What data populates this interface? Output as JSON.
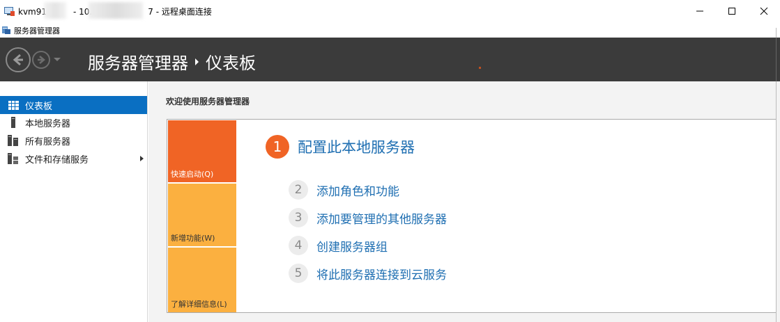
{
  "remote_desktop": {
    "title_prefix": "kvm91",
    "title_middle": "- 10.",
    "title_suffix": "7 - 远程桌面连接"
  },
  "server_manager_window": {
    "title": "服务器管理器"
  },
  "header": {
    "breadcrumb_root": "服务器管理器",
    "breadcrumb_current": "仪表板"
  },
  "sidebar": {
    "items": [
      {
        "label": "仪表板",
        "icon": "dashboard-icon",
        "active": true
      },
      {
        "label": "本地服务器",
        "icon": "local-server-icon",
        "active": false
      },
      {
        "label": "所有服务器",
        "icon": "all-servers-icon",
        "active": false
      },
      {
        "label": "文件和存储服务",
        "icon": "file-storage-icon",
        "active": false,
        "has_submenu": true
      }
    ]
  },
  "main": {
    "welcome": "欢迎使用服务器管理器",
    "tiles": [
      {
        "label": "快速启动(Q)",
        "color": "#f06425"
      },
      {
        "label": "新增功能(W)",
        "color": "#fbb040"
      },
      {
        "label": "了解详细信息(L)",
        "color": "#fbb040"
      }
    ],
    "steps": [
      {
        "num": "1",
        "label": "配置此本地服务器"
      },
      {
        "num": "2",
        "label": "添加角色和功能"
      },
      {
        "num": "3",
        "label": "添加要管理的其他服务器"
      },
      {
        "num": "4",
        "label": "创建服务器组"
      },
      {
        "num": "5",
        "label": "将此服务器连接到云服务"
      }
    ]
  },
  "colors": {
    "accent_blue": "#0a6fc2",
    "link_blue": "#1f6fb2",
    "orange": "#f06425",
    "light_orange": "#fbb040",
    "header_dark": "#3b3b3b"
  }
}
